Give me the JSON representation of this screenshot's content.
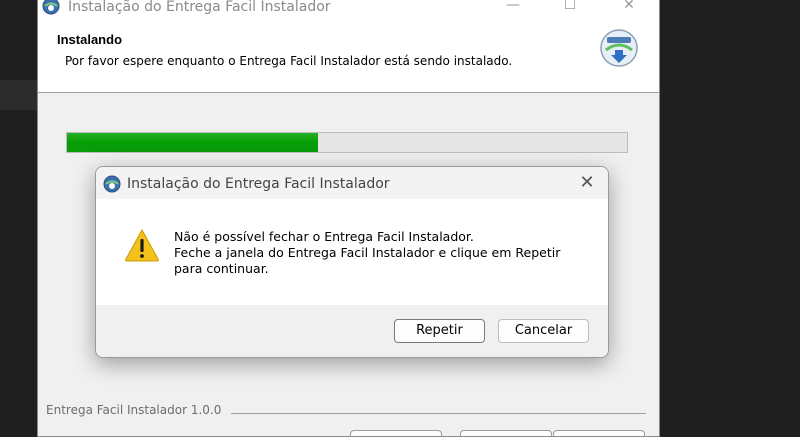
{
  "installer": {
    "window_title": "Instalação do Entrega Facil Instalador",
    "header_title": "Instalando",
    "header_subtitle": "Por favor espere enquanto o Entrega Facil Instalador está sendo instalado.",
    "progress_fraction": 0.448,
    "footer_brand": "Entrega Facil Instalador 1.0.0"
  },
  "dialog": {
    "title": "Instalação do Entrega Facil Instalador",
    "message_lines": [
      "Não é possível fechar o Entrega Facil Instalador.",
      "Feche a janela do Entrega Facil Instalador e clique em Repetir",
      "para continuar."
    ],
    "retry_label": "Repetir",
    "cancel_label": "Cancelar",
    "icon": "warning-icon"
  },
  "colors": {
    "progress_green": "#06a006",
    "warning_yellow": "#f4c21a"
  }
}
